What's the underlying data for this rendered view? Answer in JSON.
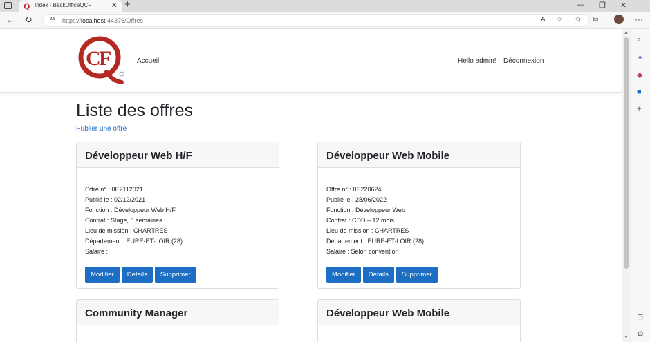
{
  "browser": {
    "tab_title": "Index - BackOfficeQCF",
    "url_prefix": "https://",
    "url_host": "localhost",
    "url_path": ":44376/Offres"
  },
  "header": {
    "logo_text": "QCF",
    "nav_home": "Accueil",
    "greeting": "Hello admin!",
    "logout": "Déconnexion"
  },
  "main": {
    "title": "Liste des offres",
    "publish_link": "Publier une offre",
    "cards": [
      {
        "title": "Développeur Web H/F",
        "offer_no": "Offre n° : 0E2112021",
        "published": "Publié le : 02/12/2021",
        "function": "Fonction : Développeur Web H/F",
        "contract": "Contrat : Stage, 8 semaines",
        "location": "Lieu de mission : CHARTRES",
        "department": "Département : EURE-ET-LOIR (28)",
        "salary": "Salaire :"
      },
      {
        "title": "Développeur Web Mobile",
        "offer_no": "Offre n° : 0E220624",
        "published": "Publié le : 28/06/2022",
        "function": "Fonction : Développeur Web",
        "contract": "Contrat : CDD – 12 mois",
        "location": "Lieu de mission : CHARTRES",
        "department": "Département : EURE-ET-LOIR (28)",
        "salary": "Salaire : Selon convention"
      },
      {
        "title": "Community Manager"
      },
      {
        "title": "Développeur Web Mobile"
      }
    ],
    "btn_edit": "Modifier",
    "btn_details": "Details",
    "btn_delete": "Supprimer"
  },
  "colors": {
    "primary": "#1b6ec2",
    "logo_red": "#b42a22"
  }
}
